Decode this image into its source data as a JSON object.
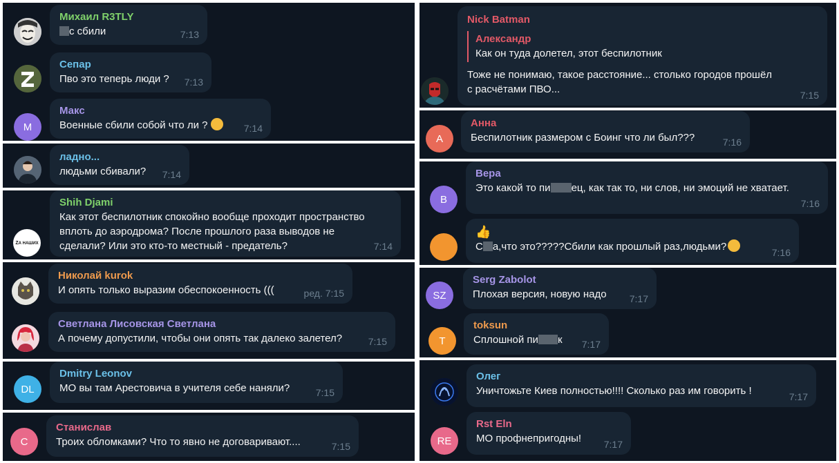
{
  "left": [
    {
      "name": "Михаил R3TLY",
      "name_color": "#7fd16b",
      "avatar_initials": "",
      "avatar_icon": "mask-icon",
      "avatar_bg": "#d9d9d9",
      "parts": [
        "",
        "с сбили"
      ],
      "time": "7:13"
    },
    {
      "name": "Сепар",
      "name_color": "#6bc0e8",
      "avatar_initials": "",
      "avatar_icon": "z-letter-icon",
      "avatar_bg": "#4b5a36",
      "parts": [
        "Пво это теперь люди ?"
      ],
      "time": "7:13"
    },
    {
      "name": "Макс",
      "name_color": "#a695e7",
      "avatar_initials": "M",
      "avatar_bg": "#8a6de0",
      "parts": [
        "Военные сбили собой что ли ?"
      ],
      "emoji": "angry-face-icon",
      "time": "7:14"
    },
    {
      "name": "ладно...",
      "name_color": "#6bc0e8",
      "avatar_initials": "",
      "avatar_icon": "person-photo-icon",
      "avatar_bg": "#3c4a5a",
      "parts": [
        "людьми сбивали?"
      ],
      "time": "7:14"
    },
    {
      "name": "Shih Djami",
      "name_color": "#7fd16b",
      "avatar_initials": "",
      "avatar_icon": "za-nashih-logo-icon",
      "avatar_logo_text": "ZА НАШИХ",
      "avatar_bg": "#ffffff",
      "text_lines": [
        "Как этот беспилотник спокойно вообще проходит пространство",
        "вплоть до аэродрома? После прошлого раза выводов не",
        "сделали? Или это кто-то местный - предатель?"
      ],
      "time": "7:14"
    },
    {
      "name": "Николай kurok",
      "name_color": "#ee9a4d",
      "avatar_initials": "",
      "avatar_icon": "cat-photo-icon",
      "avatar_bg": "#8a8a82",
      "parts": [
        "И опять только выразим обеспокоенность ((("
      ],
      "edited": "ред.",
      "time": "7:15"
    },
    {
      "name": "Светлана Лисовская Светлана",
      "name_color": "#a695e7",
      "avatar_initials": "",
      "avatar_icon": "woman-photo-icon",
      "avatar_bg": "#c84a6a",
      "parts": [
        "А почему допустили, чтобы они опять так далеко залетел?"
      ],
      "time": "7:15"
    },
    {
      "name": "Dmitry Leonov",
      "name_color": "#6bc0e8",
      "avatar_initials": "DL",
      "avatar_bg": "#3fb1e6",
      "parts": [
        "МО вы там Арестовича в учителя себе наняли?"
      ],
      "time": "7:15"
    },
    {
      "name": "Станислав",
      "name_color": "#e8698a",
      "avatar_initials": "C",
      "avatar_bg": "#e8698a",
      "parts": [
        "Троих обломками? Что то явно не договаривают...."
      ],
      "time": "7:15"
    }
  ],
  "right": [
    {
      "name": "Nick Batman",
      "name_color": "#e35967",
      "avatar_initials": "",
      "avatar_icon": "hero-photo-icon",
      "avatar_bg": "#3c1a1a",
      "reply_name": "Александр",
      "reply_text": "Как он туда долетел, этот беспилотник",
      "text_lines": [
        "Тоже не понимаю, такое расстояние... столько городов прошёл",
        "с расчётами ПВО..."
      ],
      "time": "7:15"
    },
    {
      "name": "Анна",
      "name_color": "#e35967",
      "avatar_initials": "A",
      "avatar_bg": "#e86a58",
      "parts": [
        "Беспилотник размером с Боинг что ли был???"
      ],
      "time": "7:16"
    },
    {
      "name": "Вера",
      "name_color": "#a695e7",
      "avatar_initials": "B",
      "avatar_bg": "#8a6de0",
      "parts": [
        "Это какой то пи",
        "ец, как так то, ни слов, ни эмоций не хватает."
      ],
      "time": "7:16"
    },
    {
      "name": "",
      "name_color": "#a695e7",
      "avatar_initials": "",
      "avatar_bg": "#f2952f",
      "thumb": "thumbs-up-icon",
      "parts": [
        "С",
        "а,что это?????Сбили как прошлый раз,людьми?"
      ],
      "emoji": "facepalm-icon",
      "time": "7:16"
    },
    {
      "name": "Serg Zabolot",
      "name_color": "#a695e7",
      "avatar_initials": "SZ",
      "avatar_bg": "#8a6de0",
      "parts": [
        "Плохая версия, новую надо"
      ],
      "time": "7:17"
    },
    {
      "name": "toksun",
      "name_color": "#ee9a4d",
      "avatar_initials": "T",
      "avatar_bg": "#f2952f",
      "parts": [
        "Сплошной пи",
        "к"
      ],
      "time": "7:17"
    },
    {
      "name": "Олег",
      "name_color": "#6bc0e8",
      "avatar_initials": "",
      "avatar_icon": "zodiac-icon",
      "avatar_bg": "#0b1e5a",
      "parts": [
        "Уничтожьте Киев полностью!!!! Сколько раз им говорить !"
      ],
      "time": "7:17"
    },
    {
      "name": "Rst Eln",
      "name_color": "#e8698a",
      "avatar_initials": "RE",
      "avatar_bg": "#e8698a",
      "parts": [
        "МО профнепригодны!"
      ],
      "time": "7:17"
    }
  ]
}
